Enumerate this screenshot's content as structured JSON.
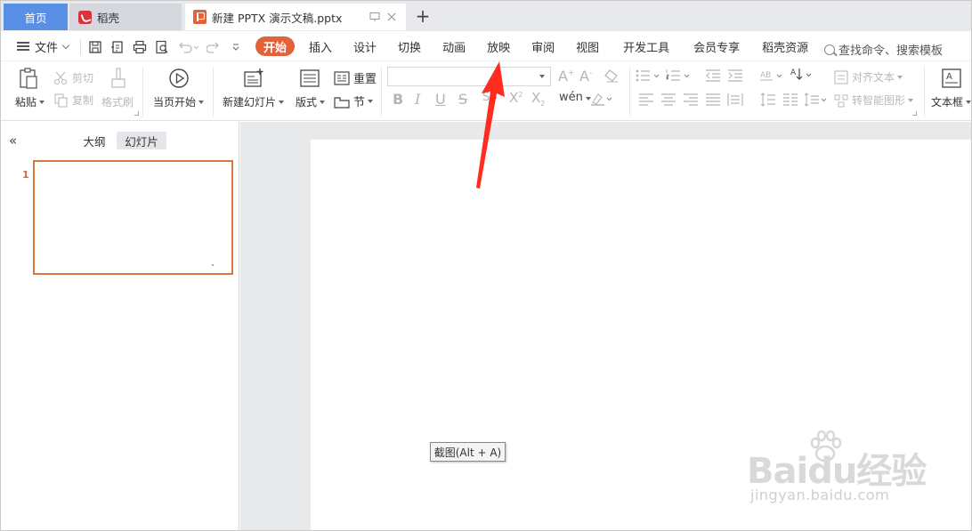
{
  "tabs": {
    "home": "首页",
    "daoke": "稻壳",
    "document": "新建 PPTX 演示文稿.pptx",
    "new_tab": "+"
  },
  "menu": {
    "file": "文件",
    "tabs": [
      "开始",
      "插入",
      "设计",
      "切换",
      "动画",
      "放映",
      "审阅",
      "视图",
      "开发工具",
      "会员专享",
      "稻壳资源"
    ],
    "active_tab": "开始",
    "search": "查找命令、搜索模板"
  },
  "ribbon": {
    "paste": "粘贴",
    "cut": "剪切",
    "copy": "复制",
    "format_painter": "格式刷",
    "from_current": "当页开始",
    "new_slide": "新建幻灯片",
    "layout": "版式",
    "reset": "重置",
    "section": "节",
    "align_text": "对齐文本",
    "smart_graphic": "转智能图形",
    "textbox": "文本框",
    "font_name": ""
  },
  "panel": {
    "outline": "大纲",
    "slides": "幻灯片",
    "active": "幻灯片",
    "slide_number": "1"
  },
  "tooltip": "截图(Alt + A)",
  "watermark": {
    "main": "Baidu经验",
    "sub": "jingyan.baidu.com"
  },
  "colors": {
    "accent": "#e3623a",
    "home_tab": "#5a8fe6",
    "arrow": "#ff2d20"
  }
}
